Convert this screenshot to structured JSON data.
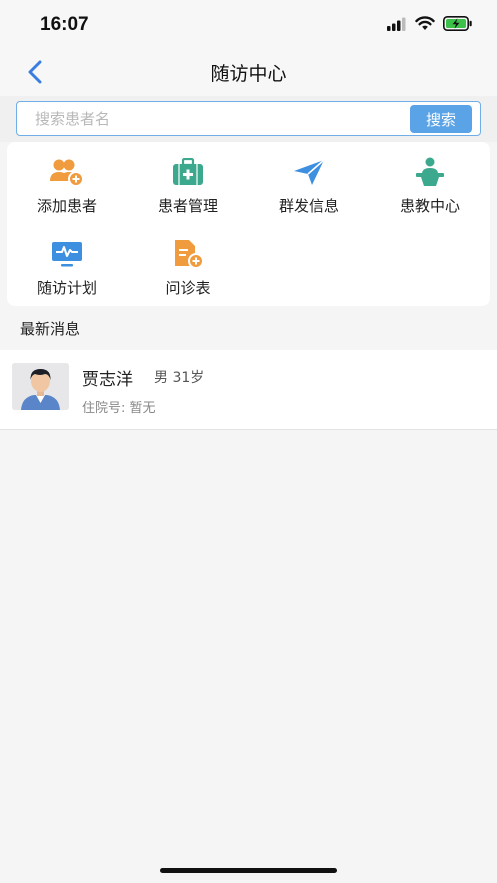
{
  "status": {
    "time": "16:07"
  },
  "nav": {
    "title": "随访中心"
  },
  "search": {
    "placeholder": "搜索患者名",
    "button_label": "搜索"
  },
  "menu": {
    "items": [
      {
        "label": "添加患者",
        "icon": "add-patient-icon",
        "color": "#ef9b3e"
      },
      {
        "label": "患者管理",
        "icon": "medical-kit-icon",
        "color": "#3ca88e"
      },
      {
        "label": "群发信息",
        "icon": "send-icon",
        "color": "#3d8fe0"
      },
      {
        "label": "患教中心",
        "icon": "lecture-icon",
        "color": "#3ca88e"
      },
      {
        "label": "随访计划",
        "icon": "monitor-pulse-icon",
        "color": "#3d8fe0"
      },
      {
        "label": "问诊表",
        "icon": "form-add-icon",
        "color": "#ef9b3e"
      }
    ]
  },
  "latest": {
    "title": "最新消息",
    "patients": [
      {
        "name": "贾志洋",
        "gender_age": "男 31岁",
        "hospital_no": "住院号: 暂无"
      }
    ]
  },
  "colors": {
    "accent": "#5aa3e6",
    "back_arrow": "#3a7fe0"
  }
}
